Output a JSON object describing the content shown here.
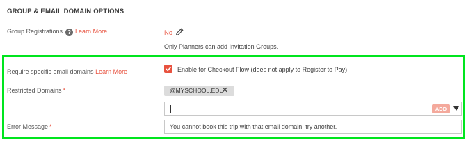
{
  "section": {
    "title": "GROUP & EMAIL DOMAIN OPTIONS"
  },
  "group_registrations": {
    "label": "Group Registrations",
    "help": "?",
    "learn_more": "Learn More",
    "value": "No",
    "note": "Only Planners can add Invitation Groups."
  },
  "require_domains": {
    "label": "Require specific email domains",
    "learn_more": "Learn More",
    "checkbox_label": "Enable for Checkout Flow (does not apply to Register to Pay)",
    "checked": true
  },
  "restricted_domains": {
    "label": "Restricted Domains",
    "required_mark": "*",
    "tags": [
      "@MYSCHOOL.EDU"
    ],
    "add_label": "ADD"
  },
  "error_message": {
    "label": "Error Message",
    "required_mark": "*",
    "value": "You cannot book this trip with that email domain, try another."
  },
  "colors": {
    "accent": "#e8523f",
    "highlight": "#00e51e"
  }
}
